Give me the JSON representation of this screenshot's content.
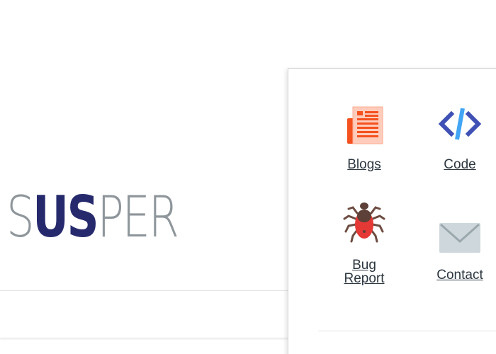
{
  "logo": {
    "part1": "S",
    "part2": "US",
    "part3": "PER"
  },
  "apps_menu": {
    "items": [
      {
        "label": "Blogs",
        "icon": "newspaper-icon"
      },
      {
        "label": "Code",
        "icon": "code-icon"
      },
      {
        "label": "Bug Report",
        "icon": "bug-icon"
      },
      {
        "label": "Contact",
        "icon": "envelope-icon"
      }
    ]
  },
  "colors": {
    "logo_light": "#8e969b",
    "logo_dark": "#262a6d",
    "link": "#2d3740",
    "news_orange": "#f4511e",
    "code_blue": "#3f51b5",
    "code_light_blue": "#42a5f5",
    "bug_red": "#e53935",
    "envelope_gray": "#ced8dc"
  }
}
